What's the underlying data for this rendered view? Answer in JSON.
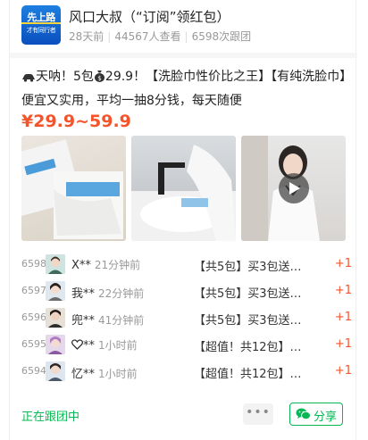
{
  "header": {
    "logo_line1": "先上路",
    "logo_line2": "才有同行者",
    "title": "风口大叔（“订阅”领红包）",
    "time_ago": "28天前",
    "views": "44567人查看",
    "follows": "6598次跟团"
  },
  "post": {
    "desc_part1": "天呐！5包",
    "desc_part2": "29.9！【洗脸巾性价比之王】【有纯洗脸巾】便宜又实用，平均一抽8分钱，每天随便",
    "price": "¥29.9~59.9"
  },
  "orders": [
    {
      "num": "6598",
      "name": "X**",
      "time": "21分钟前",
      "item": "【共5包】买3包送…",
      "qty": "+1"
    },
    {
      "num": "6597",
      "name": "我**",
      "time": "22分钟前",
      "item": "【共5包】买3包送…",
      "qty": "+1"
    },
    {
      "num": "6596",
      "name": "兜**",
      "time": "41分钟前",
      "item": "【共5包】买3包送…",
      "qty": "+1"
    },
    {
      "num": "6595",
      "name": "**",
      "time": "1小时前",
      "item": "【超值！共12包】…",
      "qty": "+1"
    },
    {
      "num": "6594",
      "name": "忆**",
      "time": "1小时前",
      "item": "【超值！共12包】…",
      "qty": "+1"
    }
  ],
  "footer": {
    "status": "正在跟团中",
    "more": "•••",
    "share": "分享"
  },
  "colors": {
    "accent": "#f5542b",
    "green": "#07b753",
    "brand_blue": "#1e7fe0"
  },
  "icons": [
    "car-icon",
    "money-bag-icon",
    "play-icon",
    "heart-icon",
    "wechat-icon"
  ]
}
